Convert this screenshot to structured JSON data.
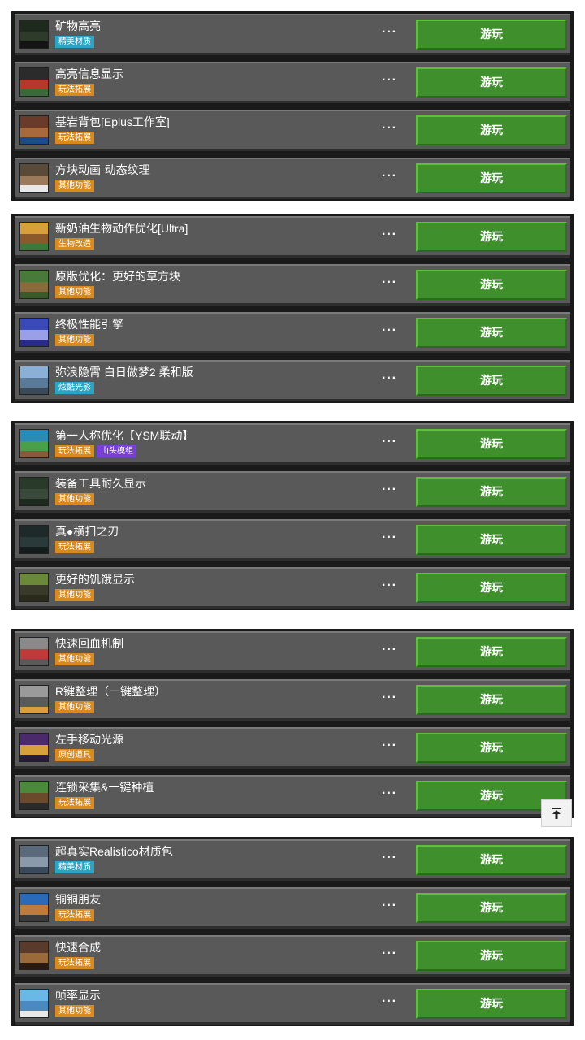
{
  "groups": [
    {
      "items": [
        {
          "title": "矿物高亮",
          "tags": [
            {
              "text": "精美材质",
              "color": "teal"
            }
          ],
          "more": "···",
          "play": "游玩",
          "thumb": [
            "#1f2a1f",
            "#2e3b2a",
            "#141414"
          ]
        },
        {
          "title": "高亮信息显示",
          "tags": [
            {
              "text": "玩法拓展",
              "color": "orange"
            }
          ],
          "more": "···",
          "play": "游玩",
          "thumb": [
            "#2b2b2b",
            "#b33a2a",
            "#3a6a3a"
          ]
        },
        {
          "title": "基岩背包[Eplus工作室]",
          "tags": [
            {
              "text": "玩法拓展",
              "color": "orange"
            }
          ],
          "more": "···",
          "play": "游玩",
          "thumb": [
            "#6a3a2a",
            "#a86a3a",
            "#1f4a8a"
          ]
        },
        {
          "title": "方块动画-动态纹理",
          "tags": [
            {
              "text": "其他功能",
              "color": "orange"
            }
          ],
          "more": "···",
          "play": "游玩",
          "thumb": [
            "#5a4a3a",
            "#9a7a5a",
            "#e8e8e8"
          ]
        }
      ]
    },
    {
      "items": [
        {
          "title": "新奶油生物动作优化[Ultra]",
          "tags": [
            {
              "text": "生物改造",
              "color": "orange"
            }
          ],
          "more": "···",
          "play": "游玩",
          "thumb": [
            "#d8a03a",
            "#8a5a2a",
            "#3a7a3a"
          ]
        },
        {
          "title": "原版优化：更好的草方块",
          "tags": [
            {
              "text": "其他功能",
              "color": "orange"
            }
          ],
          "more": "···",
          "play": "游玩",
          "thumb": [
            "#4a7a3a",
            "#8a6a3a",
            "#3a5a2a"
          ]
        },
        {
          "title": "终极性能引擎",
          "tags": [
            {
              "text": "其他功能",
              "color": "orange"
            }
          ],
          "more": "···",
          "play": "游玩",
          "thumb": [
            "#3a4ab8",
            "#9aa0e8",
            "#2a2a8a"
          ]
        },
        {
          "title": "弥浪隐霄 白日做梦2 柔和版",
          "tags": [
            {
              "text": "炫酷光影",
              "color": "teal"
            }
          ],
          "more": "···",
          "play": "游玩",
          "thumb": [
            "#8ab0d8",
            "#5a7a9a",
            "#3a4a5a"
          ]
        }
      ]
    },
    {
      "items": [
        {
          "title": "第一人称优化【YSM联动】",
          "tags": [
            {
              "text": "玩法拓展",
              "color": "orange"
            },
            {
              "text": "山头模组",
              "color": "purple"
            }
          ],
          "more": "···",
          "play": "游玩",
          "thumb": [
            "#2a8ab8",
            "#4aa04a",
            "#8a5a3a"
          ]
        },
        {
          "title": "装备工具耐久显示",
          "tags": [
            {
              "text": "其他功能",
              "color": "orange"
            }
          ],
          "more": "···",
          "play": "游玩",
          "thumb": [
            "#2a3a2a",
            "#3a4a3a",
            "#1e2a1e"
          ]
        },
        {
          "title": "真●横扫之刃",
          "tags": [
            {
              "text": "玩法拓展",
              "color": "orange"
            }
          ],
          "more": "···",
          "play": "游玩",
          "thumb": [
            "#1e2a2a",
            "#2a3a3a",
            "#141c1c"
          ]
        },
        {
          "title": "更好的饥饿显示",
          "tags": [
            {
              "text": "其他功能",
              "color": "orange"
            }
          ],
          "more": "···",
          "play": "游玩",
          "thumb": [
            "#6a8a3a",
            "#3a3a2a",
            "#2a2a1a"
          ]
        }
      ]
    },
    {
      "items": [
        {
          "title": "快速回血机制",
          "tags": [
            {
              "text": "其他功能",
              "color": "orange"
            }
          ],
          "more": "···",
          "play": "游玩",
          "thumb": [
            "#8a8a8a",
            "#c03a3a",
            "#5a5a5a"
          ]
        },
        {
          "title": "R键整理（一键整理）",
          "tags": [
            {
              "text": "其他功能",
              "color": "orange"
            }
          ],
          "more": "···",
          "play": "游玩",
          "thumb": [
            "#9a9a9a",
            "#5a5a5a",
            "#d8a03a"
          ]
        },
        {
          "title": "左手移动光源",
          "tags": [
            {
              "text": "原创道具",
              "color": "orange"
            }
          ],
          "more": "···",
          "play": "游玩",
          "thumb": [
            "#4a2a6a",
            "#d8a03a",
            "#2a1a3a"
          ]
        },
        {
          "title": "连锁采集&一键种植",
          "tags": [
            {
              "text": "玩法拓展",
              "color": "orange"
            }
          ],
          "more": "···",
          "play": "游玩",
          "thumb": [
            "#4a8a3a",
            "#6a4a2a",
            "#2a2a2a"
          ]
        }
      ]
    },
    {
      "items": [
        {
          "title": "超真实Realistico材质包",
          "tags": [
            {
              "text": "精美材质",
              "color": "teal"
            }
          ],
          "more": "···",
          "play": "游玩",
          "thumb": [
            "#5a6a7a",
            "#8a9aaa",
            "#3a4a5a"
          ]
        },
        {
          "title": "铜铜朋友",
          "tags": [
            {
              "text": "玩法拓展",
              "color": "orange"
            }
          ],
          "more": "···",
          "play": "游玩",
          "thumb": [
            "#2a6ab8",
            "#c07a3a",
            "#3a3a3a"
          ]
        },
        {
          "title": "快速合成",
          "tags": [
            {
              "text": "玩法拓展",
              "color": "orange"
            }
          ],
          "more": "···",
          "play": "游玩",
          "thumb": [
            "#5a3a2a",
            "#9a6a3a",
            "#2a1a10"
          ]
        },
        {
          "title": "帧率显示",
          "tags": [
            {
              "text": "其他功能",
              "color": "orange"
            }
          ],
          "more": "···",
          "play": "游玩",
          "thumb": [
            "#6ab8e8",
            "#4a8ac0",
            "#e8e8e8"
          ]
        }
      ]
    }
  ],
  "scroll_top_icon": "arrow-up-to-top-icon"
}
